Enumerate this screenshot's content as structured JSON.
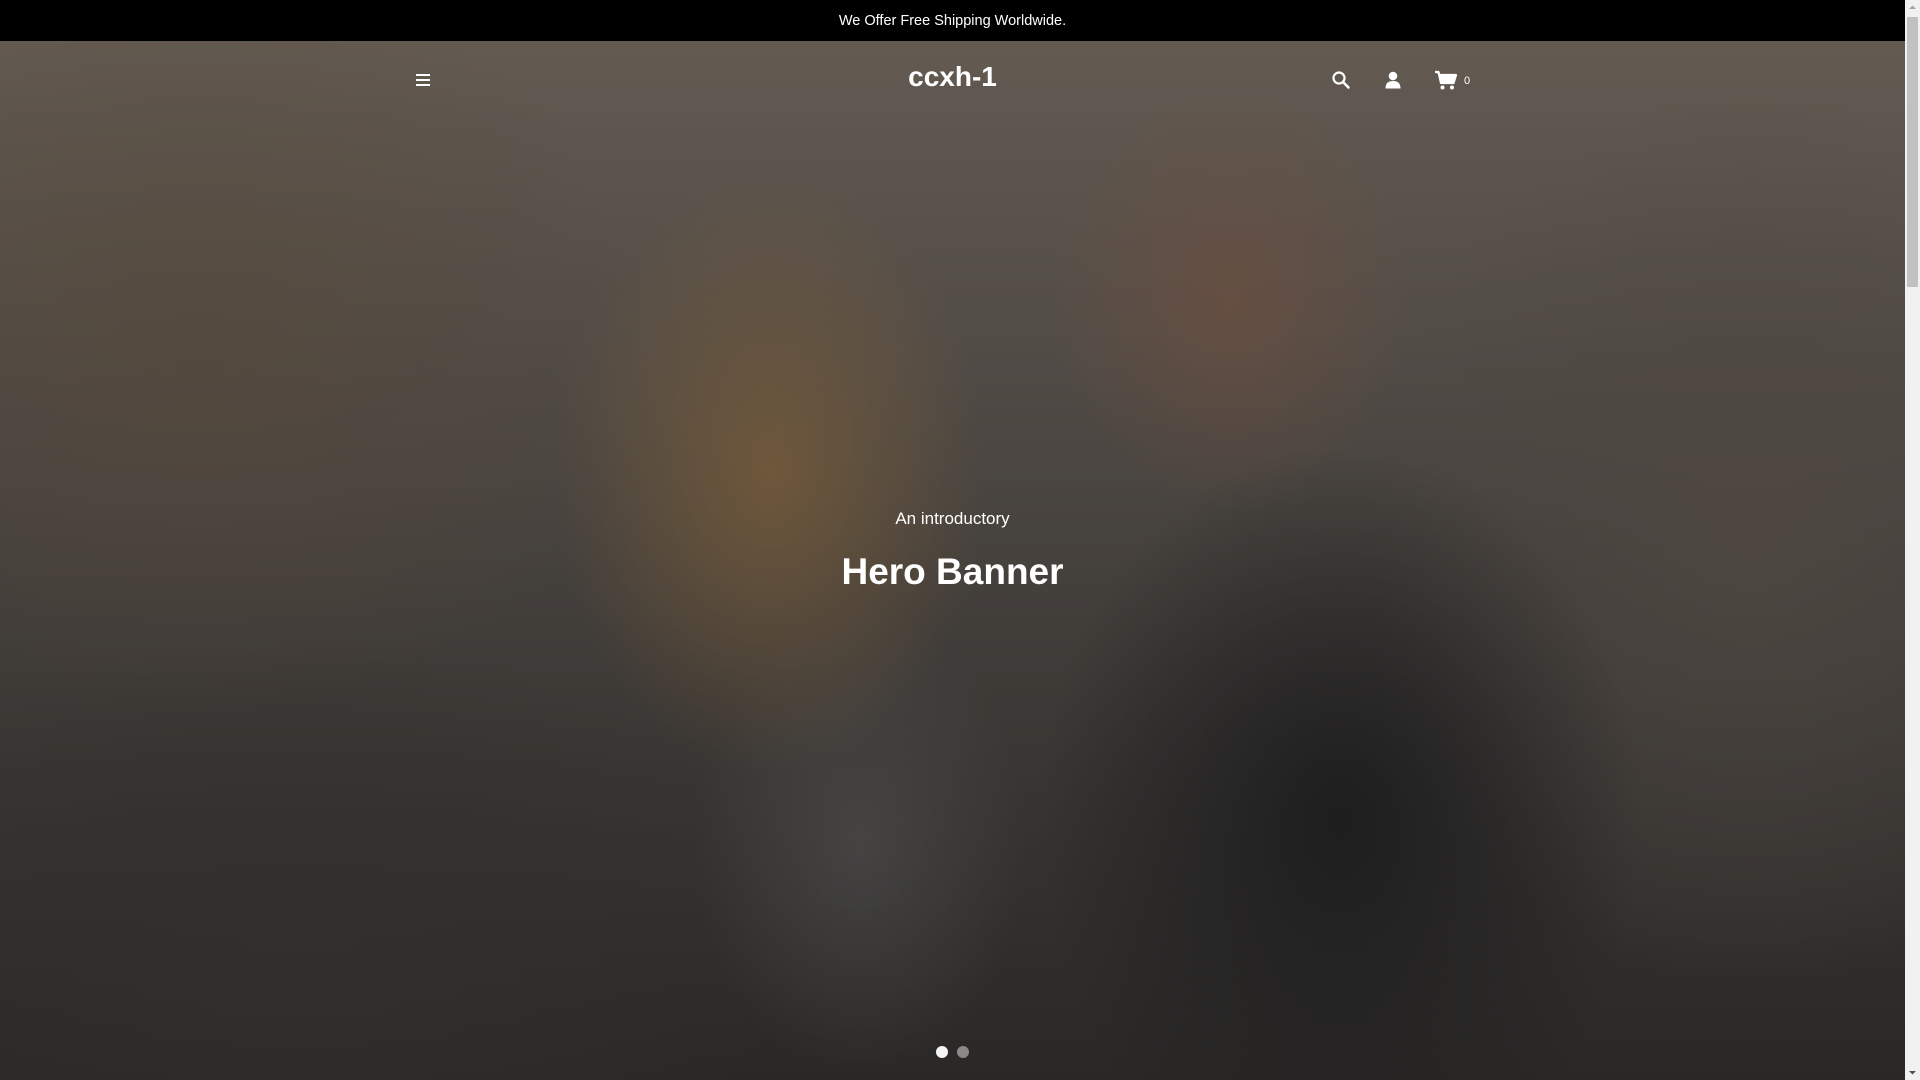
{
  "announcement": {
    "text": "We Offer Free Shipping Worldwide."
  },
  "header": {
    "logo": "ccxh-1",
    "menu_icon": "hamburger-menu-icon",
    "search_icon": "search-icon",
    "account_icon": "user-account-icon",
    "cart_icon": "shopping-cart-icon",
    "cart_count": "0"
  },
  "hero": {
    "subtitle": "An introductory",
    "title": "Hero Banner",
    "slides_total": 2,
    "active_slide": 1
  },
  "colors": {
    "announcement_bg": "#000000",
    "text": "#ffffff"
  }
}
